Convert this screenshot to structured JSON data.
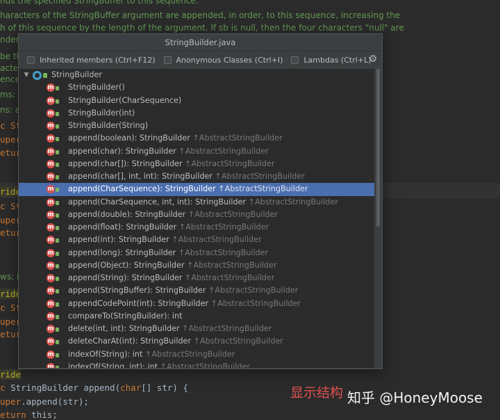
{
  "editor": {
    "doc_lines": [
      "nds the specified StringBuffer to this sequence.",
      "haracters of the StringBuffer argument are appended, in order, to this sequence, increasing the",
      "h of this sequence by the length of the argument. If sb is null, then the four characters \"null\" are",
      "nded"
    ],
    "fragments": {
      "be_th": "be th",
      "acter": "acter",
      "ence": "ence,",
      "ms_s": "ms: s",
      "ms_a": "ns: a",
      "c_St1": "c St",
      "uper1": "uper",
      "retur1": "etur",
      "ride1": "ride",
      "c_St2": "c St",
      "uper2": "uper",
      "retur2": "etur",
      "ws_I": "ws: I",
      "ride2": "ride",
      "c_St3": "c St",
      "uper3": "uper",
      "retur3": "etur",
      "ride3": "ride",
      "sig_c": "c ",
      "sig_type": "StringBuilder",
      "sig_append": " append(",
      "sig_char": "char",
      "sig_rest": "[] str) {",
      "super": "uper",
      "super_call": ".append(str);",
      "return_kw": "eturn",
      "return_this": " this;"
    }
  },
  "caption": "显示结构",
  "watermark": "知乎 @HoneyMoose",
  "popup": {
    "title": "StringBuilder.java",
    "filters": [
      {
        "label": "Inherited members (Ctrl+F12)",
        "checked": false
      },
      {
        "label": "Anonymous Classes (Ctrl+I)",
        "checked": false
      },
      {
        "label": "Lambdas (Ctrl+L)",
        "checked": false
      }
    ],
    "settings_icon": "gear-icon",
    "root": "StringBuilder",
    "member_icon_letter": "m",
    "members": [
      {
        "sig": "StringBuilder()",
        "inherit": ""
      },
      {
        "sig": "StringBuilder(CharSequence)",
        "inherit": ""
      },
      {
        "sig": "StringBuilder(int)",
        "inherit": ""
      },
      {
        "sig": "StringBuilder(String)",
        "inherit": ""
      },
      {
        "sig": "append(boolean): StringBuilder",
        "inherit": "↑AbstractStringBuilder"
      },
      {
        "sig": "append(char): StringBuilder",
        "inherit": "↑AbstractStringBuilder"
      },
      {
        "sig": "append(char[]): StringBuilder",
        "inherit": "↑AbstractStringBuilder"
      },
      {
        "sig": "append(char[], int, int): StringBuilder",
        "inherit": "↑AbstractStringBuilder"
      },
      {
        "sig": "append(CharSequence): StringBuilder",
        "inherit": "↑AbstractStringBuilder"
      },
      {
        "sig": "append(CharSequence, int, int): StringBuilder",
        "inherit": "↑AbstractStringBuilder"
      },
      {
        "sig": "append(double): StringBuilder",
        "inherit": "↑AbstractStringBuilder"
      },
      {
        "sig": "append(float): StringBuilder",
        "inherit": "↑AbstractStringBuilder"
      },
      {
        "sig": "append(int): StringBuilder",
        "inherit": "↑AbstractStringBuilder"
      },
      {
        "sig": "append(long): StringBuilder",
        "inherit": "↑AbstractStringBuilder"
      },
      {
        "sig": "append(Object): StringBuilder",
        "inherit": "↑AbstractStringBuilder"
      },
      {
        "sig": "append(String): StringBuilder",
        "inherit": "↑AbstractStringBuilder"
      },
      {
        "sig": "append(StringBuffer): StringBuilder",
        "inherit": "↑AbstractStringBuilder"
      },
      {
        "sig": "appendCodePoint(int): StringBuilder",
        "inherit": "↑AbstractStringBuilder"
      },
      {
        "sig": "compareTo(StringBuilder): int",
        "inherit": ""
      },
      {
        "sig": "delete(int, int): StringBuilder",
        "inherit": "↑AbstractStringBuilder"
      },
      {
        "sig": "deleteCharAt(int): StringBuilder",
        "inherit": "↑AbstractStringBuilder"
      },
      {
        "sig": "indexOf(String): int",
        "inherit": "↑AbstractStringBuilder"
      },
      {
        "sig": "indexOf(String, int): int",
        "inherit": "↑AbstractStringBuilder"
      }
    ],
    "selected_index": 8,
    "colors": {
      "selection": "#4b6eaf",
      "method_icon": "#d9534f",
      "class_icon": "#40a0c8"
    }
  }
}
